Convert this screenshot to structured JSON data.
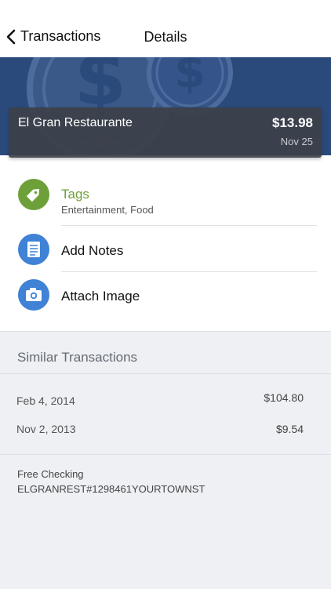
{
  "nav": {
    "back_label": "Transactions",
    "title": "Details"
  },
  "transaction": {
    "merchant": "El Gran Restaurante",
    "amount": "$13.98",
    "date": "Nov 25"
  },
  "actions": {
    "tags": {
      "label": "Tags",
      "value": "Entertainment, Food",
      "color": "#6ea03a"
    },
    "notes": {
      "label": "Add Notes",
      "color": "#3f82d6"
    },
    "image": {
      "label": "Attach Image",
      "color": "#3f82d6"
    }
  },
  "similar": {
    "title": "Similar Transactions",
    "rows": [
      {
        "date": "Feb 4, 2014",
        "amount": "$104.80"
      },
      {
        "date": "Nov 2, 2013",
        "amount": "$9.54"
      }
    ]
  },
  "account": {
    "name": "Free Checking",
    "description": "ELGRANREST#1298461YOURTOWNST"
  },
  "colors": {
    "hero_background": "#2b4a7c",
    "accent_green": "#6ea03a",
    "accent_blue": "#3f82d6"
  }
}
